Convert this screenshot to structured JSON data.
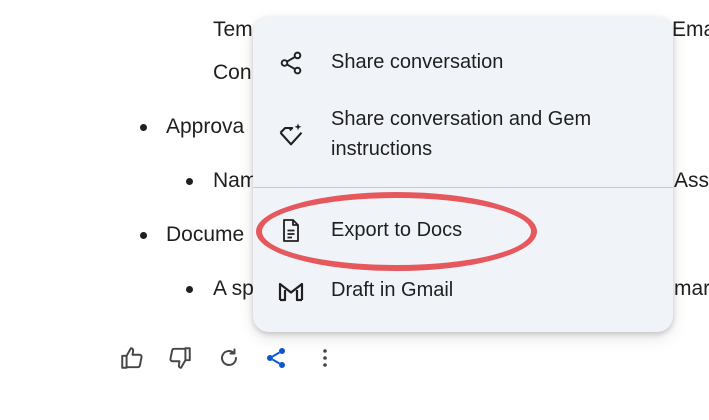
{
  "background_text": {
    "line1": "Tem",
    "line1_right": "Ema",
    "line2": "Con",
    "item_approval": "Approva",
    "item_approval_sub": "Nam",
    "item_approval_sub_right": "Assu",
    "item_document": "Docume",
    "item_document_sub": "A sp",
    "item_document_sub_right": "mar"
  },
  "menu": {
    "items": [
      {
        "label": "Share conversation",
        "icon": "share-icon"
      },
      {
        "label": "Share conversation and Gem instructions",
        "line1": "Share conversation and Gem",
        "line2": "instructions",
        "icon": "gem-icon"
      },
      {
        "label": "Export to Docs",
        "icon": "docs-icon"
      },
      {
        "label": "Draft in Gmail",
        "icon": "gmail-icon"
      }
    ]
  },
  "actions": [
    "thumbs-up-icon",
    "thumbs-down-icon",
    "regenerate-icon",
    "share-icon",
    "more-vert-icon"
  ],
  "colors": {
    "menu_bg": "#f0f4f9",
    "annotation": "#e5585d",
    "share_active": "#0b57d0",
    "icon": "#444746"
  }
}
